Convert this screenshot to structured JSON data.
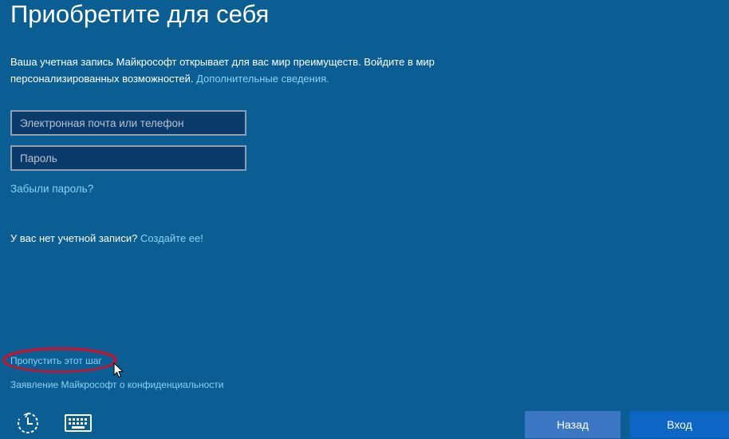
{
  "page": {
    "title": "Приобретите для себя",
    "intro_text": "Ваша учетная запись Майкрософт открывает для вас мир преимуществ. Войдите в мир персонализированных возможностей.",
    "intro_link": "Дополнительные сведения."
  },
  "form": {
    "email_placeholder": "Электронная почта или телефон",
    "password_placeholder": "Пароль",
    "forgot_password": "Забыли пароль?"
  },
  "account": {
    "no_account_text": "У вас нет учетной записи?",
    "create_link": "Создайте ее!"
  },
  "footer": {
    "skip_link": "Пропустить этот шаг",
    "privacy_link": "Заявление Майкрософт о конфиденциальности"
  },
  "buttons": {
    "back": "Назад",
    "login": "Вход"
  },
  "icons": {
    "ease_of_access": "ease-of-access-icon",
    "keyboard": "keyboard-icon",
    "cursor": "mouse-pointer-icon"
  },
  "colors": {
    "background": "#0a5e93",
    "link": "#8fd0f5",
    "field_background": "#0b3b6b",
    "back_button": "#3b77c4",
    "login_button": "#0d66c6",
    "highlight_ring": "#d0102a"
  }
}
